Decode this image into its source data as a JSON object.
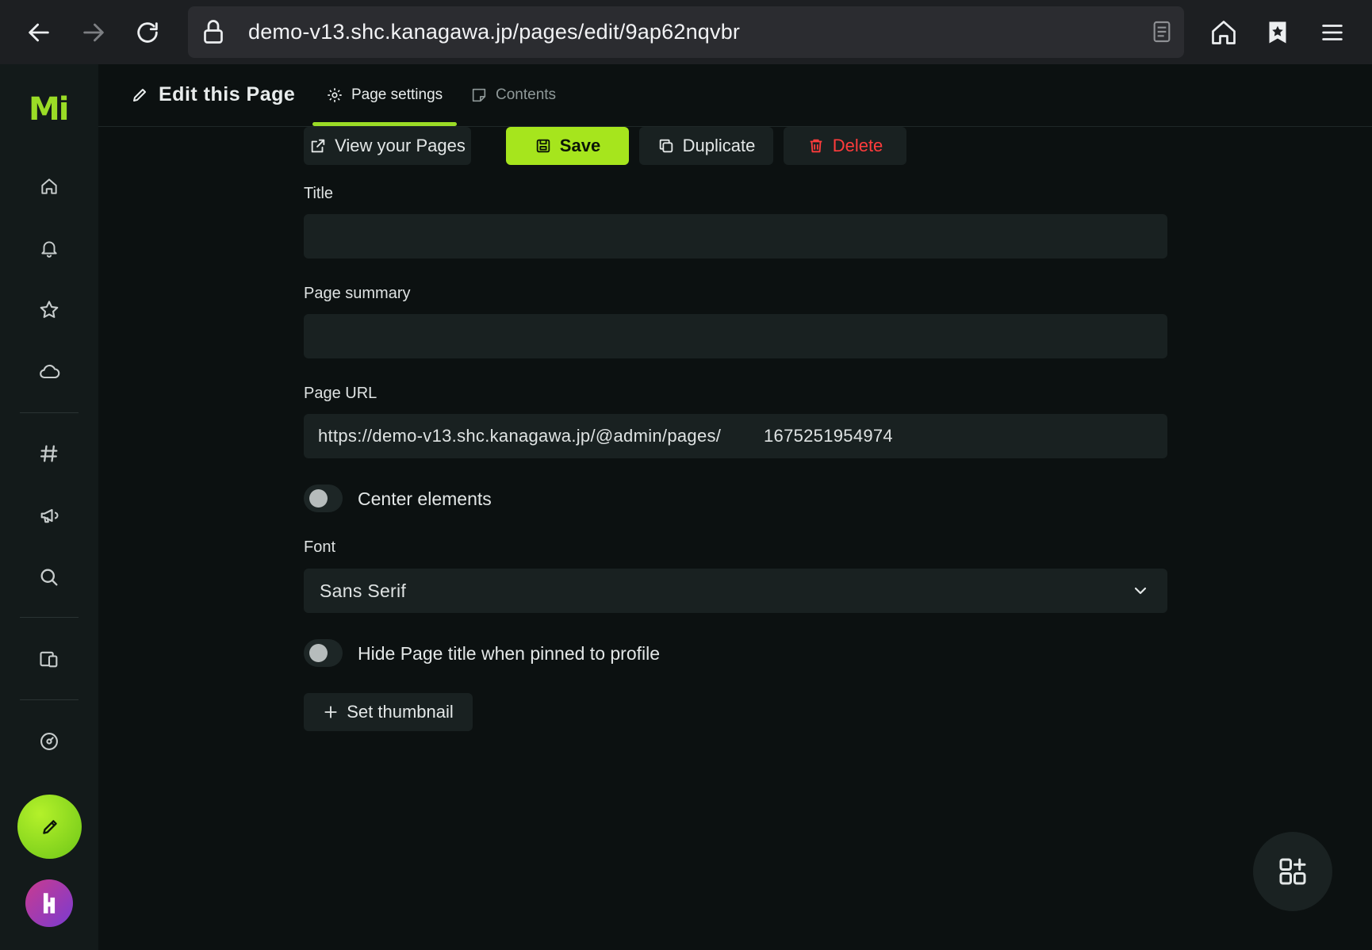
{
  "browser": {
    "url": "demo-v13.shc.kanagawa.jp/pages/edit/9ap62nqvbr"
  },
  "sidebar": {
    "logo": "Mi",
    "items": [
      {
        "icon": "home-icon"
      },
      {
        "icon": "bell-icon"
      },
      {
        "icon": "star-icon"
      },
      {
        "icon": "cloud-icon"
      },
      {
        "icon": "hashtag-icon"
      },
      {
        "icon": "megaphone-icon"
      },
      {
        "icon": "search-icon"
      },
      {
        "icon": "devices-icon"
      },
      {
        "icon": "gauge-icon"
      }
    ]
  },
  "header": {
    "title": "Edit this Page",
    "tabs": [
      {
        "label": "Page settings",
        "active": true
      },
      {
        "label": "Contents",
        "active": false
      }
    ]
  },
  "actions": {
    "view_label": "View your Pages",
    "save_label": "Save",
    "duplicate_label": "Duplicate",
    "delete_label": "Delete"
  },
  "form": {
    "title_label": "Title",
    "title_value": "",
    "summary_label": "Page summary",
    "summary_value": "",
    "url_label": "Page URL",
    "url_prefix": "https://demo-v13.shc.kanagawa.jp/@admin/pages/",
    "url_value": "1675251954974",
    "center_label": "Center elements",
    "center_on": false,
    "font_label": "Font",
    "font_value": "Sans Serif",
    "hide_title_label": "Hide Page title when pinned to profile",
    "hide_title_on": false,
    "thumbnail_label": "Set thumbnail"
  },
  "colors": {
    "accent": "#9bdc26",
    "danger": "#ff3c3c",
    "background": "#0c1111"
  }
}
